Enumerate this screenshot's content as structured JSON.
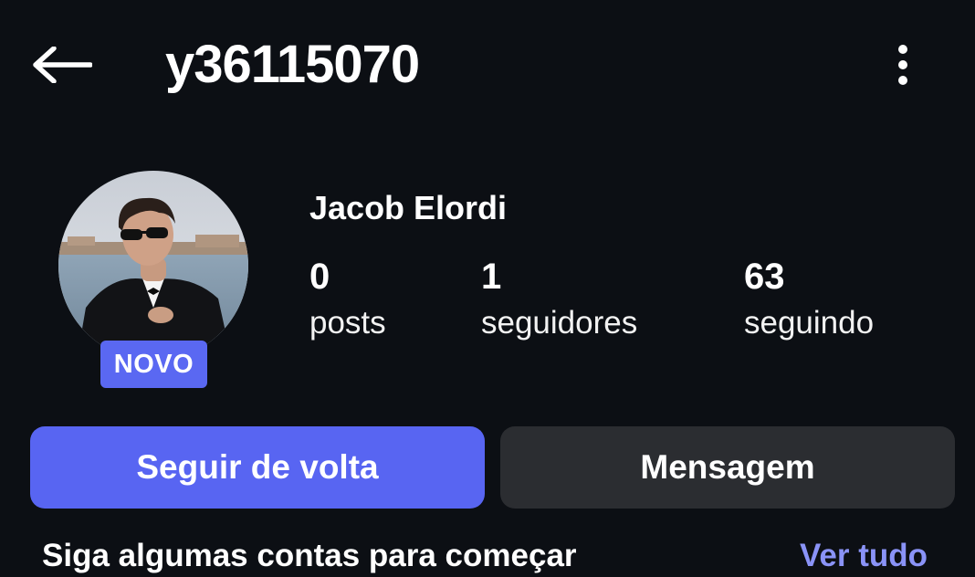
{
  "header": {
    "username": "y36115070",
    "back_icon": "arrow-left-icon",
    "more_icon": "more-vertical-icon"
  },
  "profile": {
    "display_name": "Jacob Elordi",
    "badge": "NOVO",
    "stats": [
      {
        "value": "0",
        "label": "posts"
      },
      {
        "value": "1",
        "label": "seguidores"
      },
      {
        "value": "63",
        "label": "seguindo"
      }
    ]
  },
  "actions": {
    "follow_back": "Seguir de volta",
    "message": "Mensagem"
  },
  "suggestions": {
    "title": "Siga algumas contas para começar",
    "see_all": "Ver tudo"
  },
  "colors": {
    "background": "#0c0f14",
    "primary": "#5865f2",
    "secondary": "#2b2d31",
    "link": "#8a93f7"
  }
}
